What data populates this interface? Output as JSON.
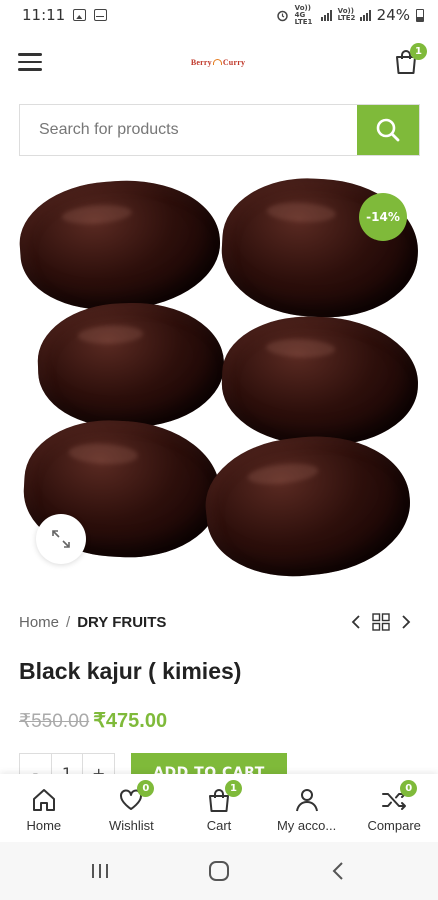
{
  "status_bar": {
    "time": "11:11",
    "carrier1": "Vo)) 4G LTE1",
    "carrier2": "Vo)) LTE2",
    "battery": "24%"
  },
  "header": {
    "logo_text_left": "Berry",
    "logo_text_right": "Curry",
    "cart_count": "1"
  },
  "search": {
    "placeholder": "Search for products"
  },
  "product": {
    "sale_badge": "-14%",
    "breadcrumb_home": "Home",
    "breadcrumb_sep": "/",
    "breadcrumb_current": "DRY FRUITS",
    "title": "Black kajur ( kimies)",
    "old_price": "₹550.00",
    "new_price": "₹475.00",
    "qty_minus": "-",
    "qty_value": "1",
    "qty_plus": "+",
    "add_to_cart": "ADD TO CART"
  },
  "bottom_nav": [
    {
      "label": "Home",
      "icon": "home-icon",
      "badge": ""
    },
    {
      "label": "Wishlist",
      "icon": "heart-icon",
      "badge": "0"
    },
    {
      "label": "Cart",
      "icon": "bag-icon",
      "badge": "1"
    },
    {
      "label": "My acco...",
      "icon": "user-icon",
      "badge": ""
    },
    {
      "label": "Compare",
      "icon": "shuffle-icon",
      "badge": "0"
    }
  ],
  "colors": {
    "accent": "#7fba3a",
    "text": "#222222"
  }
}
